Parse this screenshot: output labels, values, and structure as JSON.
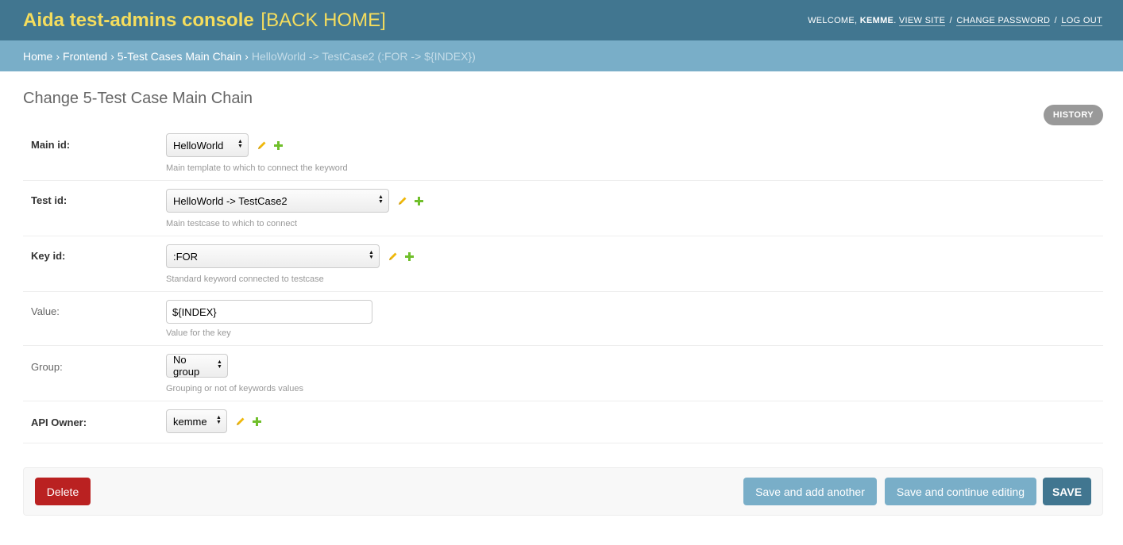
{
  "header": {
    "site_name": "Aida test-admins console",
    "back_home": "[BACK HOME]",
    "welcome": "WELCOME,",
    "user": "KEMME",
    "view_site": "VIEW SITE",
    "change_password": "CHANGE PASSWORD",
    "log_out": "LOG OUT",
    "separator": "/"
  },
  "breadcrumbs": {
    "items": [
      "Home",
      "Frontend",
      "5-Test Cases Main Chain"
    ],
    "current": "HelloWorld -> TestCase2 (:FOR -> ${INDEX})",
    "arrow": "›"
  },
  "page": {
    "title": "Change 5-Test Case Main Chain",
    "history": "HISTORY"
  },
  "form": {
    "main_id": {
      "label": "Main id:",
      "value": "HelloWorld",
      "help": "Main template to which to connect the keyword"
    },
    "test_id": {
      "label": "Test id:",
      "value": "HelloWorld -> TestCase2",
      "help": "Main testcase to which to connect"
    },
    "key_id": {
      "label": "Key id:",
      "value": ":FOR",
      "help": "Standard keyword connected to testcase"
    },
    "value": {
      "label": "Value:",
      "value": "${INDEX}",
      "help": "Value for the key"
    },
    "group": {
      "label": "Group:",
      "value": "No group",
      "help": "Grouping or not of keywords values"
    },
    "api_owner": {
      "label": "API Owner:",
      "value": "kemme"
    }
  },
  "actions": {
    "delete": "Delete",
    "save_add_another": "Save and add another",
    "save_continue": "Save and continue editing",
    "save": "SAVE"
  },
  "colors": {
    "header_bg": "#417690",
    "breadcrumbs_bg": "#79aec8",
    "brand_yellow": "#f5dd5d",
    "delete_red": "#ba2121",
    "change_icon": "#efb80b",
    "add_icon": "#70bf2b"
  }
}
